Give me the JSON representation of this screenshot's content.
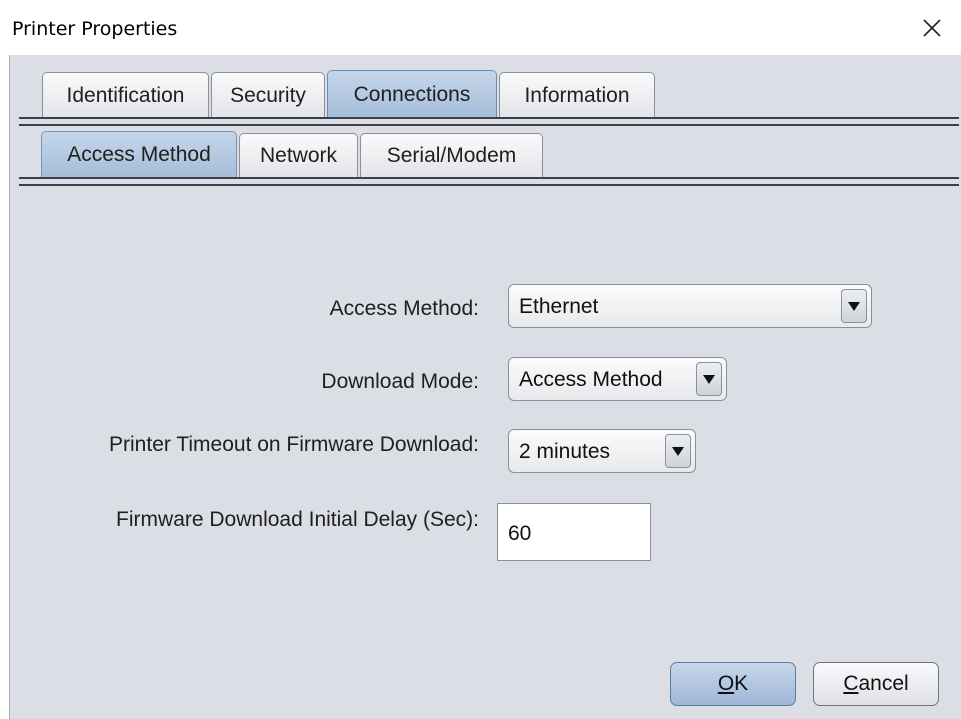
{
  "window": {
    "title": "Printer Properties"
  },
  "top_tabs": [
    {
      "label": "Identification",
      "selected": false
    },
    {
      "label": "Security",
      "selected": false
    },
    {
      "label": "Connections",
      "selected": true
    },
    {
      "label": "Information",
      "selected": false
    }
  ],
  "sub_tabs": [
    {
      "label": "Access Method",
      "selected": true
    },
    {
      "label": "Network",
      "selected": false
    },
    {
      "label": "Serial/Modem",
      "selected": false
    }
  ],
  "form": {
    "access_method": {
      "label": "Access Method:",
      "value": "Ethernet"
    },
    "download_mode": {
      "label": "Download Mode:",
      "value": "Access Method"
    },
    "printer_timeout": {
      "label": "Printer Timeout on Firmware Download:",
      "value": "2 minutes"
    },
    "initial_delay": {
      "label": "Firmware Download Initial Delay (Sec):",
      "value": "60"
    }
  },
  "buttons": {
    "ok": {
      "mnemonic": "O",
      "rest": "K"
    },
    "cancel": {
      "mnemonic": "C",
      "rest": "ancel"
    }
  },
  "icons": {
    "close": "close-icon",
    "dropdown": "chevron-down-icon"
  },
  "colors": {
    "panel": "#dcdee5",
    "selected_tab": "#b3c8e2",
    "default_button": "#b2c7e0"
  }
}
